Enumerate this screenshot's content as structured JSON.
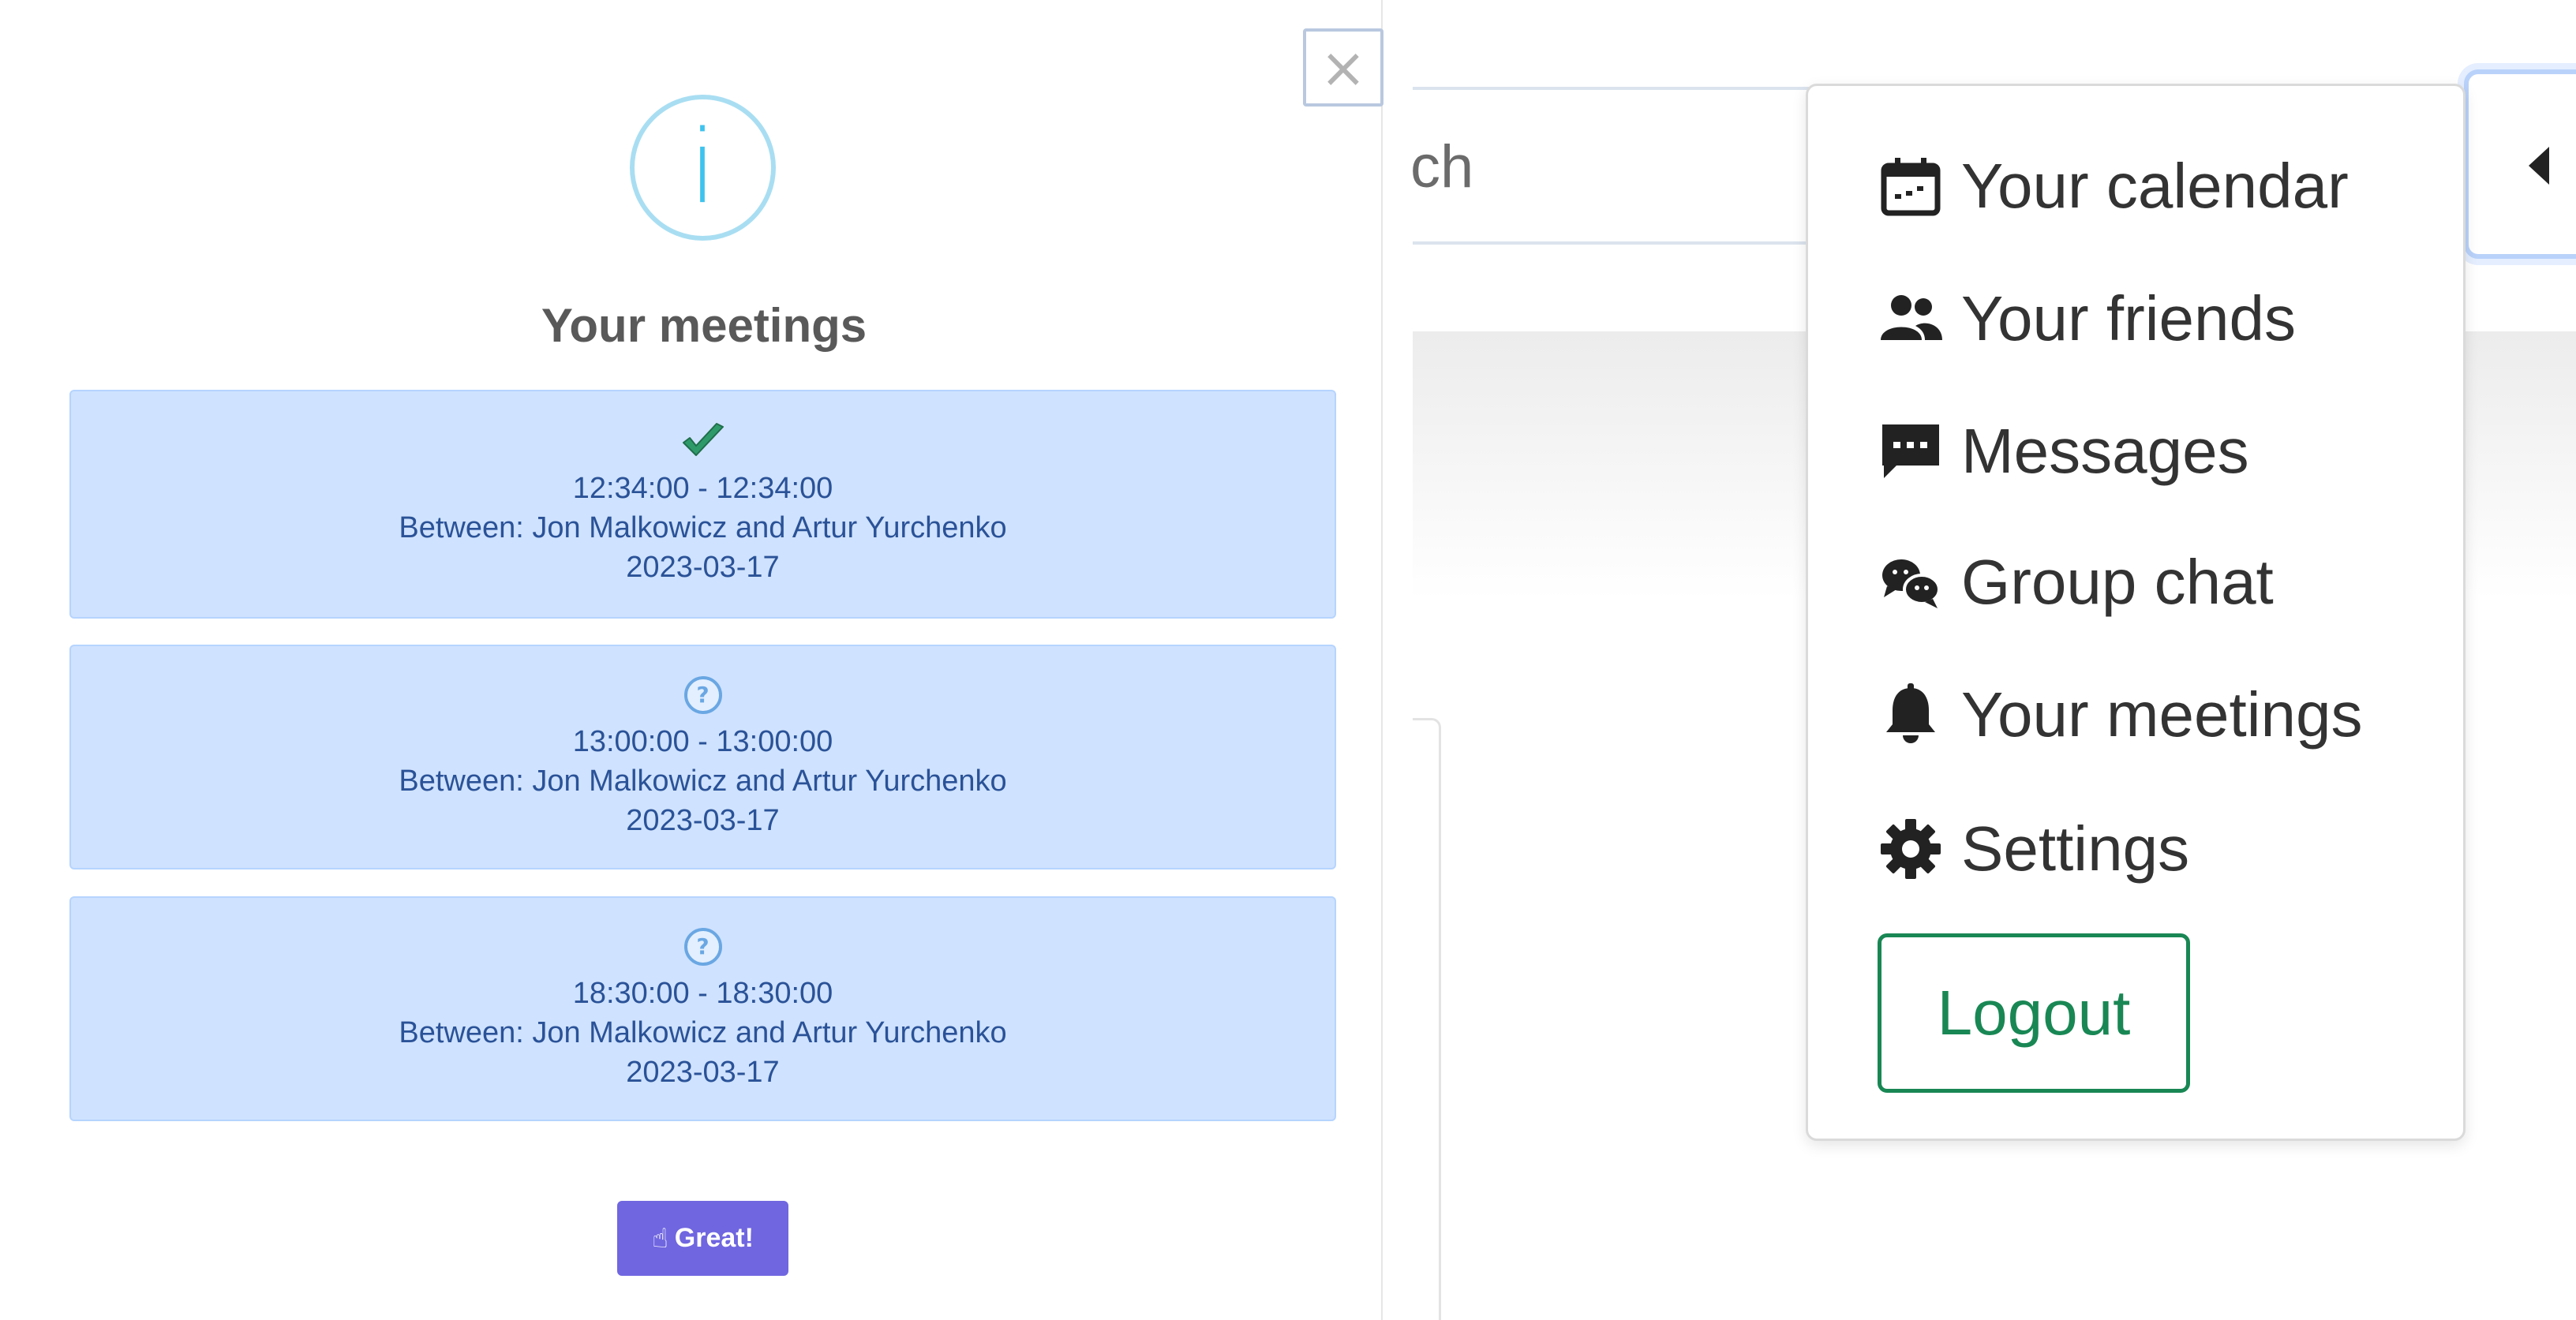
{
  "modal": {
    "close_symbol": "×",
    "info_symbol": "i",
    "title": "Your meetings",
    "meetings": [
      {
        "status": "accepted",
        "status_icon": "check-icon",
        "time": "12:34:00 - 12:34:00",
        "between": "Between: Jon Malkowicz and Artur Yurchenko",
        "date": "2023-03-17"
      },
      {
        "status": "pending",
        "status_icon": "question-icon",
        "time": "13:00:00 - 13:00:00",
        "between": "Between: Jon Malkowicz and Artur Yurchenko",
        "date": "2023-03-17"
      },
      {
        "status": "pending",
        "status_icon": "question-icon",
        "time": "18:30:00 - 18:30:00",
        "between": "Between: Jon Malkowicz and Artur Yurchenko",
        "date": "2023-03-17"
      }
    ],
    "confirm_label": "Great!",
    "confirm_icon": "thumbs-up-icon"
  },
  "page": {
    "search_partial_text": "ch"
  },
  "dropdown": {
    "items": [
      {
        "label": "Your calendar",
        "icon": "calendar-icon"
      },
      {
        "label": "Your friends",
        "icon": "friends-icon"
      },
      {
        "label": "Messages",
        "icon": "message-icon"
      },
      {
        "label": "Group chat",
        "icon": "group-chat-icon"
      },
      {
        "label": "Your meetings",
        "icon": "bell-icon"
      },
      {
        "label": "Settings",
        "icon": "gear-icon"
      }
    ],
    "logout_label": "Logout"
  },
  "colors": {
    "card_background": "#cfe2ff",
    "card_text": "#2a5297",
    "confirm_button": "#7066e0",
    "logout_green": "#198754",
    "info_blue": "#3fc3ee"
  }
}
